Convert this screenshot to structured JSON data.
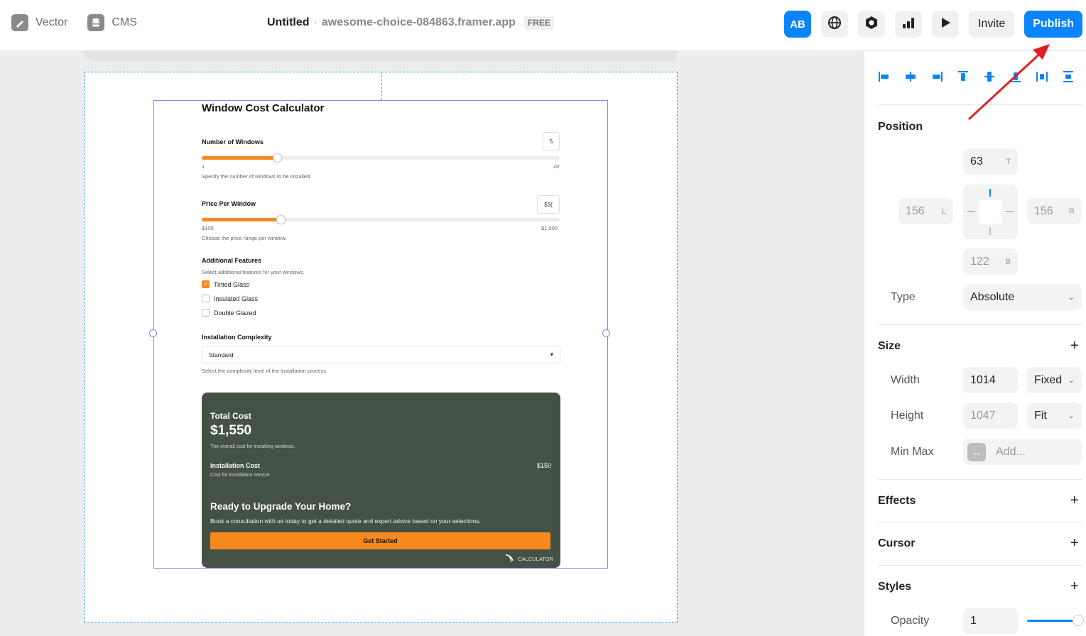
{
  "topbar": {
    "vector_label": "Vector",
    "cms_label": "CMS",
    "title": "Untitled",
    "separator": "·",
    "domain": "awesome-choice-084863.framer.app",
    "plan_badge": "FREE",
    "ab_label": "AB",
    "invite_label": "Invite",
    "publish_label": "Publish"
  },
  "calculator": {
    "title": "Window Cost Calculator",
    "windows": {
      "label": "Number of Windows",
      "value": "5",
      "min": "1",
      "max": "20",
      "fill_fraction": 0.21,
      "help": "Specify the number of windows to be installed."
    },
    "price": {
      "label": "Price Per Window",
      "value": "$3(",
      "min": "$100",
      "max": "$1,000",
      "fill_fraction": 0.22,
      "help": "Choose the price range per window."
    },
    "features": {
      "label": "Additional Features",
      "help": "Select additional features for your windows.",
      "items": [
        {
          "label": "Tinted Glass",
          "checked": true
        },
        {
          "label": "Insulated Glass",
          "checked": false
        },
        {
          "label": "Double Glazed",
          "checked": false
        }
      ]
    },
    "complexity": {
      "label": "Installation Complexity",
      "value": "Standard",
      "help": "Select the complexity level of the installation process."
    },
    "result": {
      "total_label": "Total Cost",
      "total_value": "$1,550",
      "total_help": "The overall cost for installing windows.",
      "install_label": "Installation Cost",
      "install_value": "$150",
      "install_help": "Cost for installation service.",
      "cta_heading": "Ready to Upgrade Your Home?",
      "cta_text": "Book a consultation with us today to get a detailed quote and expert advice based on your selections.",
      "cta_button": "Get Started",
      "brand": "CALCULATOR"
    }
  },
  "panel": {
    "position": {
      "title": "Position",
      "top": "63",
      "top_suffix": "T",
      "left": "156",
      "left_suffix": "L",
      "right": "156",
      "right_suffix": "R",
      "bottom": "122",
      "bottom_suffix": "B",
      "type_label": "Type",
      "type_value": "Absolute"
    },
    "size": {
      "title": "Size",
      "width_label": "Width",
      "width_value": "1014",
      "width_mode": "Fixed",
      "height_label": "Height",
      "height_value": "1047",
      "height_mode": "Fit",
      "minmax_label": "Min Max",
      "minmax_placeholder": "Add..."
    },
    "effects_title": "Effects",
    "cursor_title": "Cursor",
    "styles": {
      "title": "Styles",
      "opacity_label": "Opacity",
      "opacity_value": "1"
    }
  },
  "colors": {
    "accent": "#0a84ff",
    "orange": "#f68a1f",
    "card_green": "#435244",
    "selection": "#9a7bf2",
    "annotation_arrow": "#e02020"
  }
}
